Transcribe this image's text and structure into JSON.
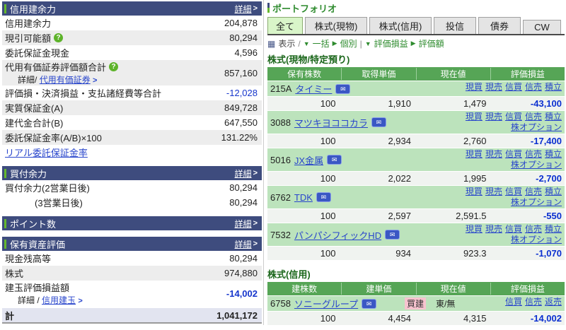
{
  "symbols": {
    "arrow": ">",
    "slash": "/",
    "slash2": " / ",
    "pipe": "|",
    "tri_down": "▼",
    "tri_right": "▶",
    "grid": "▦",
    "mail": "✉",
    "help": "?"
  },
  "left_panel": {
    "sections": {
      "margin_power": {
        "title": "信用建余力",
        "detail": "詳細",
        "rows": {
          "r1": {
            "label": "信用建余力",
            "value": "204,878"
          },
          "r2": {
            "label": "現引可能額",
            "value": "80,294"
          },
          "r3": {
            "label": "委託保証金現金",
            "value": "4,596"
          },
          "r4": {
            "label": "代用有価証券評価額合計",
            "sub_prefix": "詳細/",
            "sub_link": "代用有価証券",
            "value": "857,160"
          },
          "r5": {
            "label": "評価損・決済損益・支払諸経費等合計",
            "value": "-12,028"
          },
          "r6": {
            "label": "実質保証金(A)",
            "value": "849,728"
          },
          "r7": {
            "label": "建代金合計(B)",
            "value": "647,550"
          },
          "r8": {
            "label": "委託保証金率(A/B)×100",
            "value": "131.22%"
          },
          "r9": {
            "link": "リアル委託保証金率"
          }
        }
      },
      "buying_power": {
        "title": "買付余力",
        "detail": "詳細",
        "rows": {
          "r1": {
            "label": "買付余力(2営業日後)",
            "value": "80,294"
          },
          "r2": {
            "label": "(3営業日後)",
            "value": "80,294"
          }
        }
      },
      "points": {
        "title": "ポイント数",
        "detail": "詳細"
      },
      "assets": {
        "title": "保有資産評価",
        "detail": "詳細",
        "rows": {
          "r1": {
            "label": "現金残高等",
            "value": "80,294"
          },
          "r2": {
            "label": "株式",
            "value": "974,880"
          },
          "r3": {
            "label": "建玉評価損益額",
            "sub_prefix": "詳細 /",
            "sub_link": "信用建玉",
            "value": "-14,002"
          },
          "total": {
            "label": "計",
            "value": "1,041,172"
          }
        }
      }
    }
  },
  "portfolio": {
    "title": "ポートフォリオ",
    "tabs": {
      "all": "全て",
      "spot": "株式(現物)",
      "margin": "株式(信用)",
      "fund": "投信",
      "bond": "債券",
      "cw": "CW"
    },
    "toolbar": {
      "display": "表示",
      "bulk": "一括",
      "individual": "個別",
      "pl": "評価損益",
      "valuation": "評価額"
    },
    "actions": {
      "cash_buy": "現買",
      "cash_sell": "現売",
      "margin_buy": "信買",
      "margin_sell": "信売",
      "accumulate": "積立",
      "stock_option": "株オプション",
      "repay_sell": "返売"
    },
    "spot": {
      "label": "株式(現物/特定預り)",
      "headers": [
        "保有株数",
        "取得単価",
        "現在値",
        "評価損益"
      ],
      "rows": [
        {
          "code": "215A",
          "name": "タイミー",
          "qty": "100",
          "cost": "1,910",
          "price": "1,479",
          "pl": "-43,100"
        },
        {
          "code": "3088",
          "name": "マツキヨココカラ",
          "qty": "100",
          "cost": "2,934",
          "price": "2,760",
          "pl": "-17,400"
        },
        {
          "code": "5016",
          "name": "JX金属",
          "qty": "100",
          "cost": "2,022",
          "price": "1,995",
          "pl": "-2,700"
        },
        {
          "code": "6762",
          "name": "TDK",
          "qty": "100",
          "cost": "2,597",
          "price": "2,591.5",
          "pl": "-550"
        },
        {
          "code": "7532",
          "name": "パンパシフィックHD",
          "qty": "100",
          "cost": "934",
          "price": "923.3",
          "pl": "-1,070"
        }
      ]
    },
    "margin": {
      "label": "株式(信用)",
      "headers": [
        "建株数",
        "建単価",
        "現在値",
        "評価損益"
      ],
      "rows": [
        {
          "code": "6758",
          "name": "ソニーグループ",
          "badge": "買建",
          "market": "東/無",
          "qty": "100",
          "cost": "4,454",
          "price": "4,315",
          "pl": "-14,002"
        }
      ]
    }
  }
}
